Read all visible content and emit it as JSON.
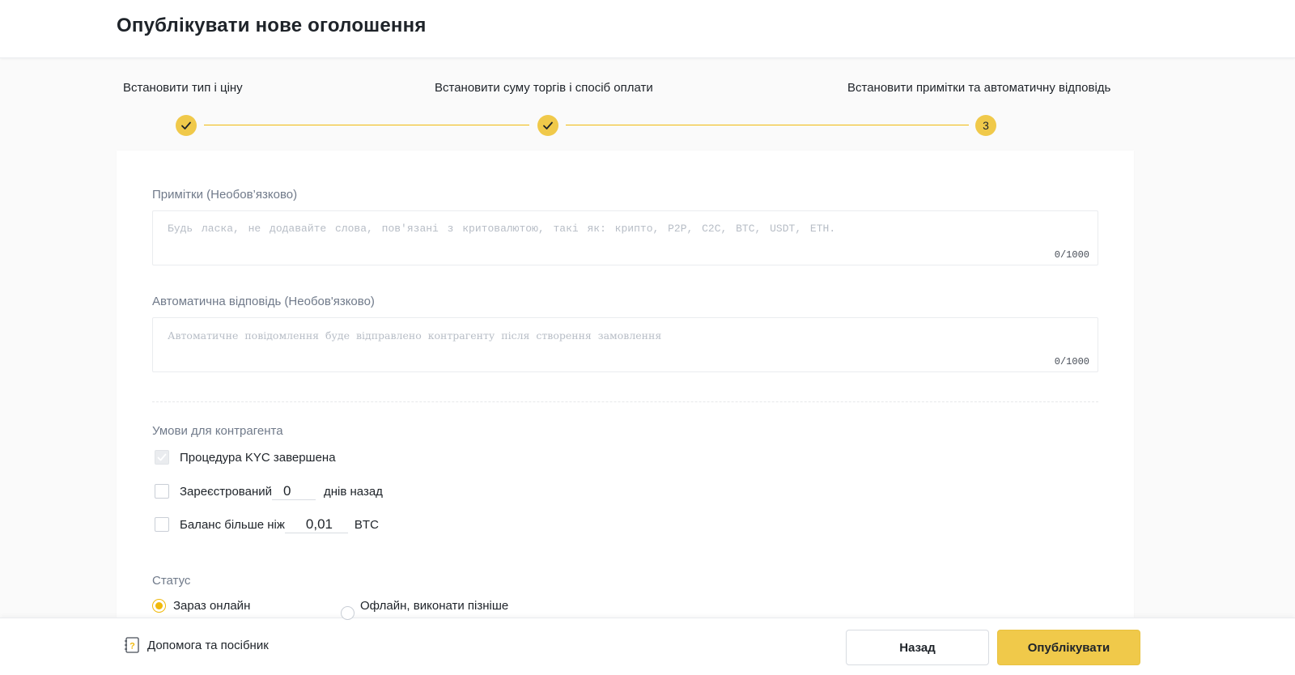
{
  "header": {
    "title": "Опублікувати нове оголошення"
  },
  "stepper": {
    "steps": [
      {
        "label": "Встановити тип і ціну",
        "state": "done"
      },
      {
        "label": "Встановити суму торгів і спосіб оплати",
        "state": "done"
      },
      {
        "label": "Встановити примітки та автоматичну відповідь",
        "state": "current",
        "number": "3"
      }
    ],
    "accent_color": "#f0b90b"
  },
  "notes": {
    "label": "Примітки (Необов’язково)",
    "placeholder": "Будь ласка, не додавайте слова, пов'язані з критовалютою, такі як: крипто, P2P, C2C, BTC, USDT, ETH.",
    "counter": "0/1000"
  },
  "auto_reply": {
    "label": "Автоматична відповідь (Необов'язково)",
    "placeholder": "Автоматичне повідомлення буде відправлено контрагенту після створення замовлення",
    "counter": "0/1000"
  },
  "conditions": {
    "label": "Умови для контрагента",
    "kyc": {
      "label": "Процедура KYC завершена",
      "checked": true,
      "disabled": true
    },
    "registered": {
      "label_before": "Зареєстрований",
      "value": "0",
      "label_after": "днів назад",
      "checked": false
    },
    "balance": {
      "label_before": "Баланс більше ніж",
      "value": "0,01",
      "label_after": "BTC",
      "checked": false
    }
  },
  "status": {
    "label": "Статус",
    "options": [
      {
        "label": "Зараз онлайн",
        "selected": true
      },
      {
        "label": "Офлайн, виконати пізніше",
        "selected": false
      }
    ]
  },
  "footer": {
    "help_label": "Допомога та посібник",
    "back_label": "Назад",
    "publish_label": "Опублікувати"
  }
}
